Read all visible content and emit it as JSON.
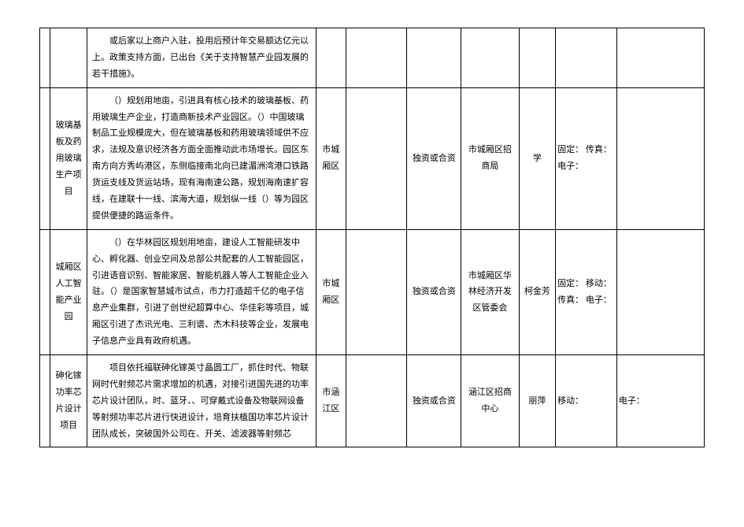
{
  "rows": [
    {
      "idx": "",
      "name": "",
      "desc": "或后家以上商户入驻，投用后预计年交易额达亿元以上。政策支持方面，已出台《关于支持智慧产业园发展的若干措施》。",
      "region": "",
      "amount": "",
      "mode": "",
      "org": "",
      "person": "",
      "contact": "",
      "extra": ""
    },
    {
      "idx": "",
      "name": "玻璃基板及药用玻璃生产项目",
      "desc": "（）规划用地亩，引进具有核心技术的玻璃基板、药用玻璃生产企业，打造商新技术产业园区。（）中国玻璃制品工业规模庞大，但在玻璃基板和药用玻璃领域供不应求，法规及意识经济各方面全面推动此市场增长。园区东南方向方秀屿港区，东侧临接南北向已建湄洲湾港口铁路货运支线及货运站场，现有海南速公路，规划海南速扩容线，在建联十一线、滨海大道，规划纵一线（）等为园区提供便捷的路运条件。",
      "region": "市城厢区",
      "amount": "",
      "mode": "独资或合资",
      "org": "市城厢区招商局",
      "person": "学",
      "contact": "固定：\n传真：\n电子：",
      "extra": ""
    },
    {
      "idx": "",
      "name": "城厢区人工智能产业园",
      "desc": "（）在华林园区规划用地亩，建设人工智能研发中心、孵化器、创业空间及总部公共配套的人工智能园区，引进语音识别、智能家居、智能机器人等人工智能企业入驻。（）是国家智慧城市试点，市力打造超千亿的电子信息产业集群，引进了创世纪超算中心、华佳彩等项目，城厢区引进了杰讯光电、三利谱、杰木科技等企业，发展电子信息产业具有政府机遇。",
      "region": "市城厢区",
      "amount": "",
      "mode": "独资或合资",
      "org": "市城厢区华林经济开发区管委会",
      "person": "柯金芳",
      "contact": "固定：\n移动：\n传真：\n电子：",
      "extra": ""
    },
    {
      "idx": "",
      "name": "砷化镓功率芯片设计项目",
      "desc": "项目依托福联砷化镓英寸晶圆工厂，抓住时代、物联网时代射频芯片需求增加的机遇，对接引进国先进的功率芯片设计团队，时、蓝牙、、可穿戴式设备及物联网设备等射频功率芯片进行快进设计，培育扶植国功率芯片设计团队成长，突破国外公司在、开关、滤波器等射频芯",
      "region": "市涵江区",
      "amount": "",
      "mode": "独资或合资",
      "org": "涵江区招商中心",
      "person": "丽萍",
      "contact": "移动：",
      "extra": "电子："
    }
  ]
}
